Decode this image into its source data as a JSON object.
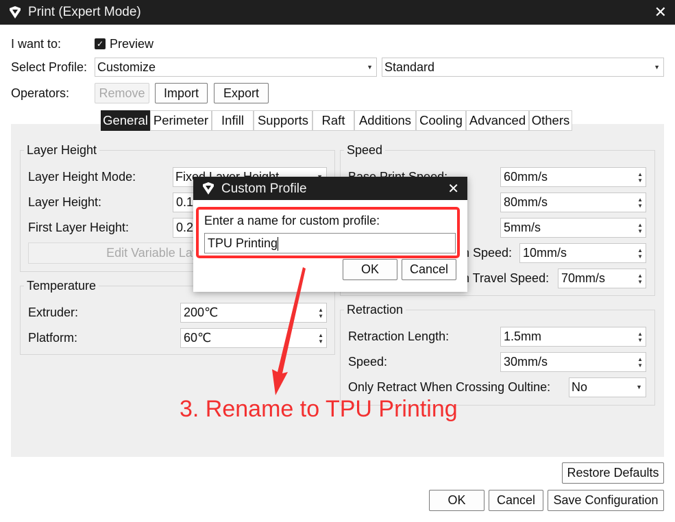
{
  "window": {
    "title": "Print (Expert Mode)"
  },
  "top": {
    "want_label": "I want to:",
    "preview_label": "Preview",
    "select_profile_label": "Select Profile:",
    "profile_value": "Customize",
    "quality_value": "Standard",
    "operators_label": "Operators:",
    "remove_label": "Remove",
    "import_label": "Import",
    "export_label": "Export"
  },
  "tabs": [
    {
      "label": "General",
      "active": true
    },
    {
      "label": "Perimeter"
    },
    {
      "label": "Infill"
    },
    {
      "label": "Supports"
    },
    {
      "label": "Raft"
    },
    {
      "label": "Additions"
    },
    {
      "label": "Cooling"
    },
    {
      "label": "Advanced"
    },
    {
      "label": "Others"
    }
  ],
  "layer": {
    "title": "Layer Height",
    "mode_label": "Layer Height Mode:",
    "mode_value": "Fixed Layer Height",
    "height_label": "Layer Height:",
    "height_value": "0.1",
    "first_label": "First Layer Height:",
    "first_value": "0.2",
    "edit_variable_label": "Edit Variable Layer Height"
  },
  "temperature": {
    "title": "Temperature",
    "extruder_label": "Extruder:",
    "extruder_value": "200℃",
    "platform_label": "Platform:",
    "platform_value": "60℃"
  },
  "speed": {
    "title": "Speed",
    "base_label": "Base Print Speed:",
    "base_value": "60mm/s",
    "value2": "80mm/s",
    "value3": "5mm/s",
    "row4_label_tail": "n Speed:",
    "row4_value": "10mm/s",
    "row5_label_tail": "n Travel Speed:",
    "row5_value": "70mm/s"
  },
  "retraction": {
    "title": "Retraction",
    "length_label": "Retraction Length:",
    "length_value": "1.5mm",
    "speed_label": "Speed:",
    "speed_value": "30mm/s",
    "only_label": "Only Retract When Crossing Oultine:",
    "only_value": "No"
  },
  "footer": {
    "restore_label": "Restore Defaults",
    "ok_label": "OK",
    "cancel_label": "Cancel",
    "save_label": "Save Configuration"
  },
  "dialog": {
    "title": "Custom Profile",
    "prompt": "Enter a name for custom profile:",
    "input_value": "TPU Printing",
    "ok_label": "OK",
    "cancel_label": "Cancel"
  },
  "annotation": {
    "text": "3. Rename to TPU Printing",
    "color": "#f33030"
  },
  "colors": {
    "titlebar": "#1f1f1f",
    "panel": "#efefef",
    "highlight": "#ff2d2d"
  }
}
